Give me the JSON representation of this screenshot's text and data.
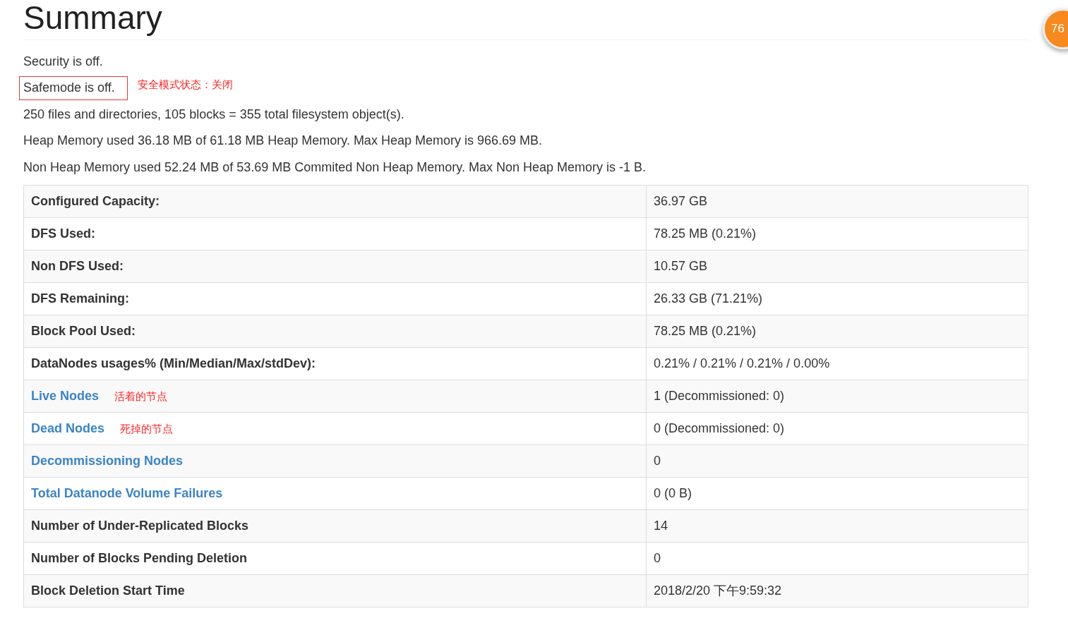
{
  "title": "Summary",
  "badge": {
    "text": "76"
  },
  "status_lines": [
    {
      "text": "Security is off.",
      "highlighted": false
    },
    {
      "text": "Safemode is off.",
      "highlighted": true,
      "note": "安全模式状态：关闭"
    },
    {
      "text": "250 files and directories, 105 blocks = 355 total filesystem object(s).",
      "highlighted": false
    },
    {
      "text": "Heap Memory used 36.18 MB of 61.18 MB Heap Memory. Max Heap Memory is 966.69 MB.",
      "highlighted": false
    },
    {
      "text": "Non Heap Memory used 52.24 MB of 53.69 MB Commited Non Heap Memory. Max Non Heap Memory is -1 B.",
      "highlighted": false
    }
  ],
  "table": {
    "rows": [
      {
        "kind": "label",
        "name": "Configured Capacity:",
        "value": "36.97 GB"
      },
      {
        "kind": "label",
        "name": "DFS Used:",
        "value": "78.25 MB (0.21%)"
      },
      {
        "kind": "label",
        "name": "Non DFS Used:",
        "value": "10.57 GB"
      },
      {
        "kind": "label",
        "name": "DFS Remaining:",
        "value": "26.33 GB (71.21%)"
      },
      {
        "kind": "label",
        "name": "Block Pool Used:",
        "value": "78.25 MB (0.21%)"
      },
      {
        "kind": "label",
        "name": "DataNodes usages% (Min/Median/Max/stdDev):",
        "value": "0.21% / 0.21% / 0.21% / 0.00%"
      },
      {
        "kind": "link",
        "name": "Live Nodes",
        "note": "活着的节点",
        "value": "1 (Decommissioned: 0)"
      },
      {
        "kind": "link",
        "name": "Dead Nodes",
        "note": "死掉的节点",
        "value": "0 (Decommissioned: 0)"
      },
      {
        "kind": "link",
        "name": "Decommissioning Nodes",
        "value": "0"
      },
      {
        "kind": "link",
        "name": "Total Datanode Volume Failures",
        "value": "0 (0 B)"
      },
      {
        "kind": "label",
        "name": "Number of Under-Replicated Blocks",
        "value": "14"
      },
      {
        "kind": "label",
        "name": "Number of Blocks Pending Deletion",
        "value": "0"
      },
      {
        "kind": "label",
        "name": "Block Deletion Start Time",
        "value": "2018/2/20 下午9:59:32"
      }
    ]
  }
}
